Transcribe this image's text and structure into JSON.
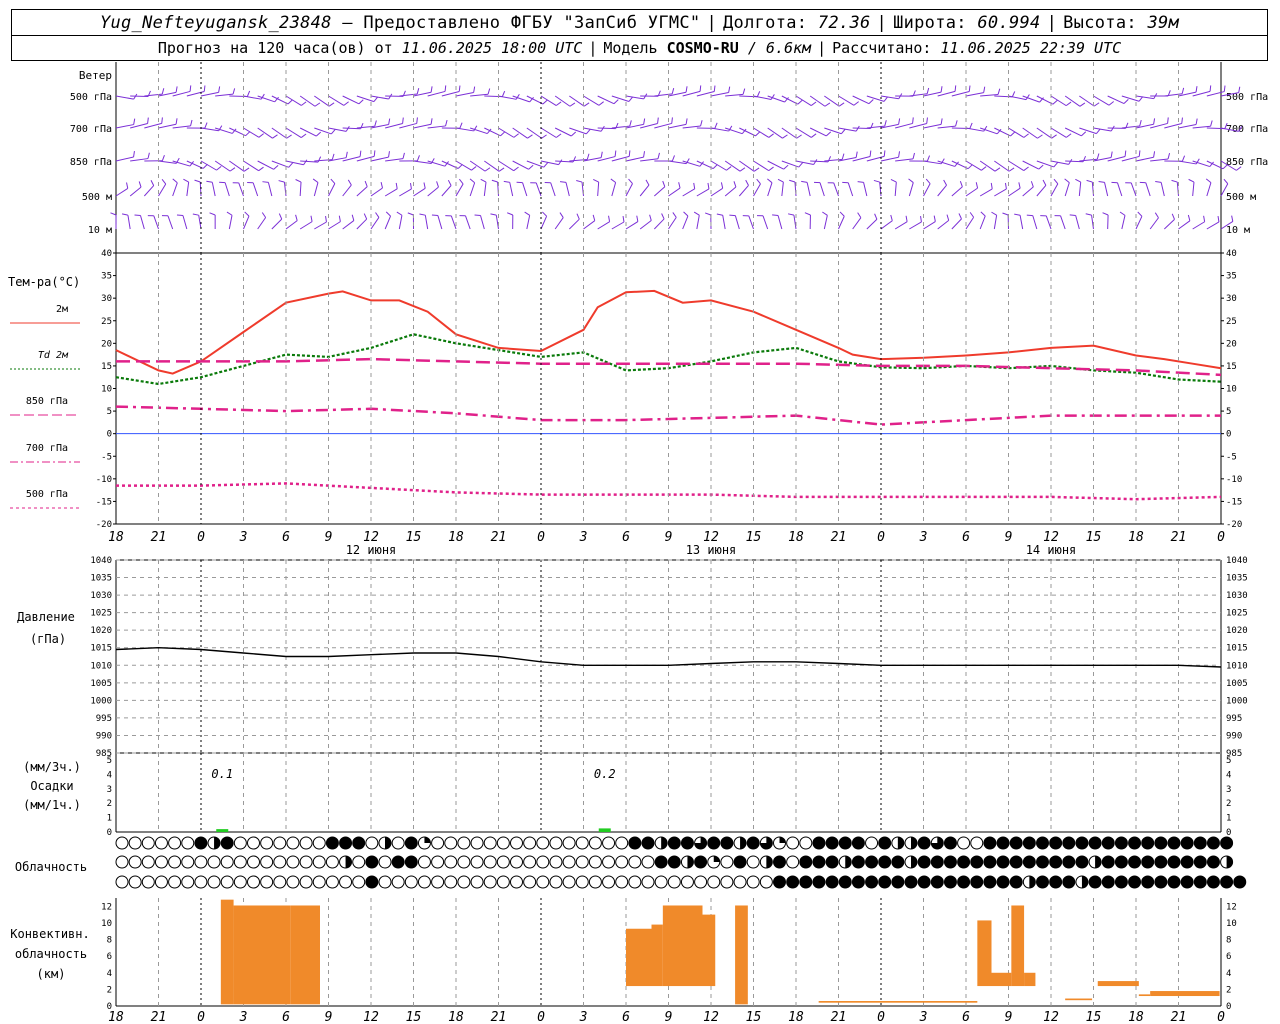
{
  "header": {
    "station": "Yug_Nefteyugansk_23848",
    "provided_by": "– Предоставлено ФГБУ \"ЗапСиб УГМС\"",
    "lon_label": "Долгота:",
    "lon": "72.36",
    "lat_label": "Широта:",
    "lat": "60.994",
    "alt_label": "Высота:",
    "alt": "39м",
    "forecast_label": "Прогноз на 120 часа(ов) от",
    "forecast_start": "11.06.2025 18:00 UTC",
    "model_label": "Модель",
    "model": "COSMO-RU",
    "resolution": "/ 6.6км",
    "computed_label": "Рассчитано:",
    "computed": "11.06.2025 22:39 UTC"
  },
  "colors": {
    "t2m": "#ef3b2c",
    "td": "#0a7a0a",
    "t850": "#e0218a",
    "t700": "#e0218a",
    "t500": "#e0218a",
    "wind": "#7b2fd6",
    "pressure": "#000000",
    "precip": "#22cc22",
    "convective": "#f08a2a",
    "zero_line": "#3355ff",
    "grid": "#9a9a9a"
  },
  "time_axis": {
    "hour_labels": [
      "18",
      "21",
      "0",
      "3",
      "6",
      "9",
      "12",
      "15",
      "18",
      "21",
      "0",
      "3",
      "6",
      "9",
      "12",
      "15",
      "18",
      "21",
      "0",
      "3",
      "6",
      "9",
      "12",
      "15",
      "18",
      "21",
      "0"
    ],
    "day_labels": [
      {
        "hour_offset": 18,
        "label": "12 июня"
      },
      {
        "hour_offset": 42,
        "label": "13 июня"
      },
      {
        "hour_offset": 66,
        "label": "14 июня"
      }
    ],
    "total_hours": 78
  },
  "wind_panel": {
    "title": "Ветер",
    "levels": [
      "500 гПа",
      "700 гПа",
      "850 гПа",
      "500 м",
      "10  м"
    ]
  },
  "chart_data": [
    {
      "type": "line",
      "title": "Тем-ра(°C)",
      "x_unit": "hours from 11.06.2025 18:00 UTC",
      "ylim": [
        -20,
        40
      ],
      "y_ticks": [
        40,
        35,
        30,
        25,
        20,
        15,
        10,
        5,
        0,
        -5,
        -10,
        -15,
        -20
      ],
      "grid": true,
      "series": [
        {
          "name": "2м",
          "x": [
            0,
            3,
            4,
            6,
            9,
            12,
            15,
            16,
            18,
            20,
            22,
            24,
            27,
            30,
            33,
            34,
            36,
            38,
            40,
            42,
            45,
            48,
            51,
            52,
            54,
            57,
            60,
            63,
            66,
            69,
            72,
            74,
            76,
            78
          ],
          "values": [
            18.5,
            14,
            13.3,
            16,
            22.5,
            29,
            31,
            31.5,
            29.5,
            29.5,
            27,
            22,
            19,
            18.3,
            23,
            28,
            31.3,
            31.6,
            29,
            29.5,
            27,
            23,
            19,
            17.5,
            16.5,
            16.8,
            17.3,
            18,
            19,
            19.5,
            17.3,
            16.5,
            15.5,
            14.5
          ]
        },
        {
          "name": "Td 2м",
          "x": [
            0,
            3,
            6,
            9,
            12,
            15,
            18,
            21,
            24,
            27,
            30,
            33,
            36,
            39,
            42,
            45,
            48,
            51,
            54,
            57,
            60,
            63,
            66,
            69,
            72,
            75,
            78
          ],
          "values": [
            12.5,
            11,
            12.5,
            15,
            17.5,
            17,
            19,
            22,
            20,
            18.5,
            17,
            18,
            14,
            14.5,
            16,
            18,
            19,
            16,
            14.7,
            14.5,
            15,
            14.5,
            15,
            14,
            13.5,
            12,
            11.5
          ]
        },
        {
          "name": "850 гПа",
          "x": [
            0,
            6,
            12,
            18,
            24,
            30,
            36,
            42,
            48,
            54,
            60,
            66,
            72,
            78
          ],
          "values": [
            16,
            16,
            16,
            16.5,
            16,
            15.5,
            15.5,
            15.5,
            15.5,
            15,
            15,
            14.5,
            14,
            13
          ]
        },
        {
          "name": "700 гПа",
          "x": [
            0,
            6,
            12,
            18,
            24,
            30,
            36,
            42,
            48,
            54,
            60,
            66,
            72,
            78
          ],
          "values": [
            6,
            5.5,
            5,
            5.5,
            4.5,
            3,
            3,
            3.5,
            4,
            2,
            3,
            4,
            4,
            4
          ]
        },
        {
          "name": "500 гПа",
          "x": [
            0,
            6,
            12,
            18,
            24,
            30,
            36,
            42,
            48,
            54,
            60,
            66,
            72,
            78
          ],
          "values": [
            -11.5,
            -11.5,
            -11,
            -12,
            -13,
            -13.5,
            -13.5,
            -13.5,
            -14,
            -14,
            -14,
            -14,
            -14.5,
            -14
          ]
        }
      ]
    },
    {
      "type": "line",
      "title": "Давление",
      "unit_label": "(гПа)",
      "ylim": [
        985,
        1040
      ],
      "y_ticks": [
        1040,
        1035,
        1030,
        1025,
        1020,
        1015,
        1010,
        1005,
        1000,
        995,
        990,
        985
      ],
      "grid": true,
      "series": [
        {
          "name": "Давление",
          "x": [
            0,
            3,
            6,
            9,
            12,
            15,
            18,
            21,
            24,
            27,
            30,
            33,
            36,
            39,
            42,
            45,
            48,
            51,
            54,
            57,
            60,
            63,
            66,
            69,
            72,
            75,
            78
          ],
          "values": [
            1014.5,
            1015,
            1014.5,
            1013.5,
            1012.5,
            1012.5,
            1013,
            1013.5,
            1013.5,
            1012.5,
            1011,
            1010,
            1010,
            1010,
            1010.5,
            1011,
            1011,
            1010.5,
            1010,
            1010,
            1010,
            1010,
            1010,
            1010,
            1010,
            1010,
            1009.5
          ]
        }
      ]
    },
    {
      "type": "bar",
      "title": "Осадки",
      "unit_top": "(мм/3ч.)",
      "unit_bottom": "(мм/1ч.)",
      "ylim": [
        0,
        5
      ],
      "y_ticks": [
        5,
        4,
        3,
        2,
        1,
        0
      ],
      "bars": [
        {
          "x": 7.5,
          "value": 0.1,
          "label": "0.1"
        },
        {
          "x": 34.5,
          "value": 0.2,
          "label": "0.2"
        }
      ]
    },
    {
      "type": "bar",
      "title": "Конвективн. облачность (км)",
      "ylim": [
        0,
        13
      ],
      "y_ticks": [
        12,
        10,
        8,
        6,
        4,
        2,
        0
      ],
      "bars": [
        {
          "x0": 7.4,
          "x1": 8.3,
          "base": 0.2,
          "top": 12.8
        },
        {
          "x0": 8.3,
          "x1": 12.3,
          "base": 0.2,
          "top": 12.1
        },
        {
          "x0": 12.3,
          "x1": 14.4,
          "base": 0.2,
          "top": 12.1
        },
        {
          "x0": 36.0,
          "x1": 37.8,
          "base": 2.4,
          "top": 9.3
        },
        {
          "x0": 37.8,
          "x1": 38.6,
          "base": 2.4,
          "top": 9.8
        },
        {
          "x0": 38.6,
          "x1": 41.4,
          "base": 2.4,
          "top": 12.1
        },
        {
          "x0": 41.4,
          "x1": 42.3,
          "base": 2.4,
          "top": 11.0
        },
        {
          "x0": 43.7,
          "x1": 44.6,
          "base": 0.2,
          "top": 12.1
        },
        {
          "x0": 49.6,
          "x1": 60.8,
          "base": 0.4,
          "top": 0.6
        },
        {
          "x0": 60.8,
          "x1": 61.8,
          "base": 2.4,
          "top": 10.3
        },
        {
          "x0": 61.8,
          "x1": 63.2,
          "base": 2.4,
          "top": 4.0
        },
        {
          "x0": 63.2,
          "x1": 64.1,
          "base": 2.4,
          "top": 12.1
        },
        {
          "x0": 64.1,
          "x1": 64.9,
          "base": 2.4,
          "top": 4.0
        },
        {
          "x0": 67.0,
          "x1": 68.9,
          "base": 0.7,
          "top": 0.9
        },
        {
          "x0": 69.3,
          "x1": 72.2,
          "base": 2.4,
          "top": 3.0
        },
        {
          "x0": 72.2,
          "x1": 73.0,
          "base": 1.2,
          "top": 1.4
        },
        {
          "x0": 73.0,
          "x1": 77.9,
          "base": 1.2,
          "top": 1.8
        }
      ]
    }
  ],
  "cloud_panel": {
    "title": "Облачность",
    "rows": [
      "000000BHB0000000BBB0H0BQ000000000000000BBHBBTBBHBTQ00BBBB0BHHBTB00BBBBBBBBBBBBBBBBBBB",
      "00000000000000000H0B0BB000000000000000000BBHBQ0B0HB0BBBHBBBBHBBBBBBBBBBBBBHBBBBBBBBBH",
      "0000000000000000000B000000000000000000000000000000BBBBBBBBBBBBBBBBBBBHBBBHBBBBBBBBBBBB"
    ]
  }
}
